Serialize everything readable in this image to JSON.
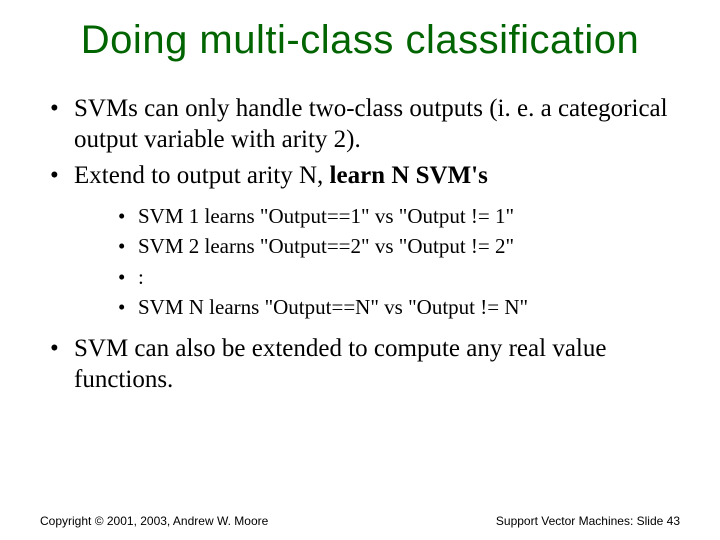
{
  "title": "Doing multi-class classification",
  "bullets": {
    "b1": "SVMs can only handle two-class outputs (i. e. a categorical output variable with arity 2).",
    "b2_pre": "Extend to output arity N, ",
    "b2_bold": "learn N SVM's",
    "sub1": "SVM 1 learns \"Output==1\" vs \"Output != 1\"",
    "sub2": "SVM 2 learns \"Output==2\" vs \"Output != 2\"",
    "sub3": ":",
    "sub4": "SVM N learns \"Output==N\" vs \"Output != N\"",
    "b3": "SVM can also be extended to compute any real value functions."
  },
  "footer": {
    "left": "Copyright © 2001, 2003, Andrew W. Moore",
    "right": "Support Vector Machines: Slide 43"
  }
}
